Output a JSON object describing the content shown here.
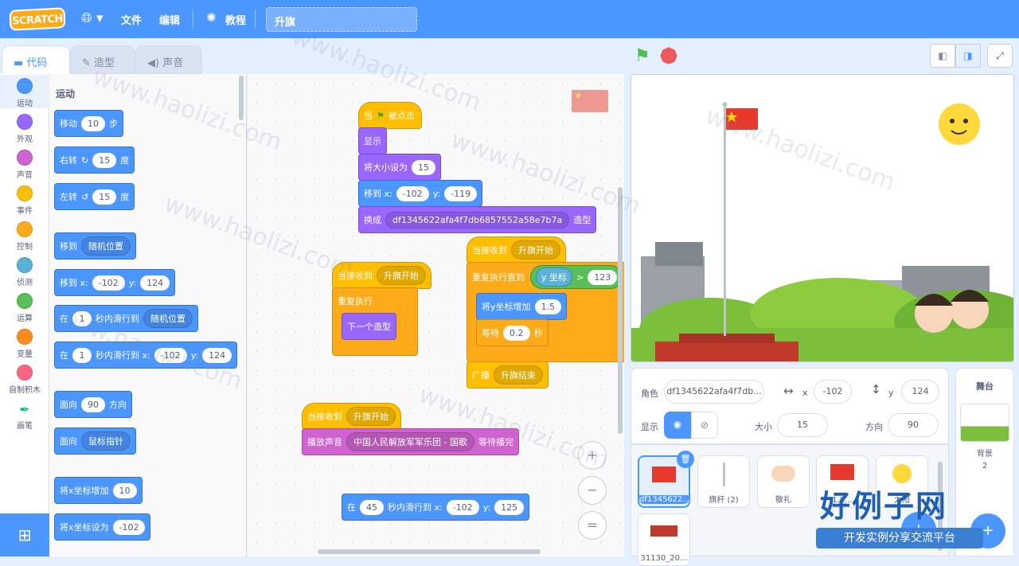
{
  "menu": {
    "logo": "SCRATCH",
    "file": "文件",
    "edit": "编辑",
    "tutorials": "教程",
    "project_title": "升旗"
  },
  "tabs": {
    "code": "代码",
    "costumes": "造型",
    "sounds": "声音"
  },
  "categories": [
    "运动",
    "外观",
    "声音",
    "事件",
    "控制",
    "侦测",
    "运算",
    "变量",
    "自制积木",
    "画笔"
  ],
  "palette": {
    "heading": "运动",
    "move": {
      "a": "移动",
      "v": "10",
      "b": "步"
    },
    "turn_right": {
      "a": "右转",
      "v": "15",
      "b": "度"
    },
    "turn_left": {
      "a": "左转",
      "v": "15",
      "b": "度"
    },
    "goto": {
      "a": "移到",
      "opt": "随机位置"
    },
    "goto_xy": {
      "a": "移到 x:",
      "x": "-102",
      "b": "y:",
      "y": "124"
    },
    "glide": {
      "a": "在",
      "v": "1",
      "b": "秒内滑行到",
      "opt": "随机位置"
    },
    "glide_xy": {
      "a": "在",
      "v": "1",
      "b": "秒内滑行到 x:",
      "x": "-102",
      "c": "y:",
      "y": "124"
    },
    "point": {
      "a": "面向",
      "v": "90",
      "b": "方向"
    },
    "point_towards": {
      "a": "面向",
      "opt": "鼠标指针"
    },
    "change_x": {
      "a": "将x坐标增加",
      "v": "10"
    },
    "set_x": {
      "a": "将x坐标设为",
      "v": "-102"
    }
  },
  "scripts": {
    "s1": {
      "hat_a": "当",
      "hat_b": "被点击",
      "show": "显示",
      "size_a": "将大小设为",
      "size_v": "15",
      "goto_a": "移到 x:",
      "goto_x": "-102",
      "goto_b": "y:",
      "goto_y": "-119",
      "costume_a": "换成",
      "costume_opt": "df1345622afa4f7db6857552a58e7b7a",
      "costume_b": "造型"
    },
    "s2": {
      "hat": "当接收到",
      "msg": "升旗开始",
      "forever": "重复执行",
      "next": "下一个造型"
    },
    "s3": {
      "hat": "当接收到",
      "msg": "升旗开始",
      "until": "重复执行直到",
      "ypos": "y 坐标",
      "gt": ">",
      "val": "123",
      "change_a": "将y坐标增加",
      "change_v": "1.5",
      "wait_a": "等待",
      "wait_v": "0.2",
      "wait_b": "秒",
      "bcast": "广播",
      "bcast_msg": "升旗结束"
    },
    "s4": {
      "hat": "当接收到",
      "msg": "升旗开始",
      "play": "播放声音",
      "sound": "中国人民解放军军乐团 - 国歌",
      "until": "等待播完"
    },
    "s5": {
      "a": "在",
      "v": "45",
      "b": "秒内滑行到 x:",
      "x": "-102",
      "c": "y:",
      "y": "125"
    }
  },
  "zoom": {
    "in": "+",
    "out": "−",
    "reset": "="
  },
  "sprite_info": {
    "sprite_label": "角色",
    "sprite_name": "df1345622afa4f7db...",
    "x_label": "x",
    "x": "-102",
    "y_label": "y",
    "y": "124",
    "show_label": "显示",
    "size_label": "大小",
    "size": "15",
    "dir_label": "方向",
    "dir": "90"
  },
  "sprites": [
    "df1345622...",
    "旗杆 (2)",
    "敬礼",
    "1.8...",
    "太阳",
    "31130_20..."
  ],
  "stage_panel": {
    "title": "舞台",
    "backdrop_label": "背景",
    "backdrop_count": "2"
  },
  "watermark": "www.haolizi.com",
  "brand": {
    "name": "好例子网",
    "tagline": "开发实例分享交流平台"
  },
  "colors": {
    "menu": "#4c97ff",
    "motion": "#4c97ff",
    "looks": "#9966ff",
    "sound": "#cf63cf",
    "event": "#ffbf00",
    "control": "#ffab19",
    "operator": "#59c059",
    "sensing": "#5cb1d6"
  }
}
